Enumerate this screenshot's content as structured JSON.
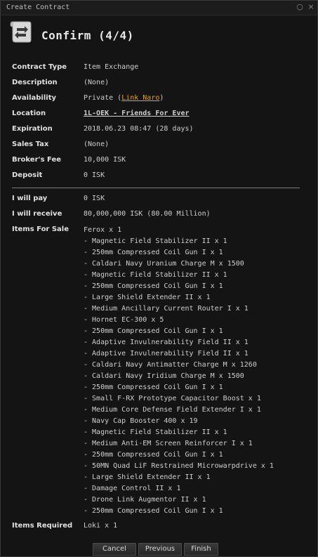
{
  "window": {
    "title": "Create Contract",
    "controls": [
      "minimize-icon",
      "close-icon"
    ]
  },
  "header": {
    "title": "Confirm (4/4)",
    "icon": "contract-scroll-icon"
  },
  "fields": {
    "contract_type": {
      "label": "Contract Type",
      "value": "Item Exchange"
    },
    "description": {
      "label": "Description",
      "value": "(None)"
    },
    "availability": {
      "label": "Availability",
      "prefix": "Private (",
      "link": "Link Naro",
      "suffix": ")"
    },
    "location": {
      "label": "Location",
      "link": "1L-OEK - Friends For Ever"
    },
    "expiration": {
      "label": "Expiration",
      "value": "2018.06.23 08:47 (28 days)"
    },
    "sales_tax": {
      "label": "Sales Tax",
      "value": "(None)"
    },
    "brokers_fee": {
      "label": "Broker's Fee",
      "value": "10,000 ISK"
    },
    "deposit": {
      "label": "Deposit",
      "value": "0 ISK"
    },
    "i_will_pay": {
      "label": "I will pay",
      "value": "0 ISK"
    },
    "i_will_receive": {
      "label": "I will receive",
      "value": "80,000,000 ISK (80.00 Million)"
    },
    "items_for_sale_label": "Items For Sale",
    "items_required": {
      "label": "Items Required",
      "value": "Loki x 1"
    }
  },
  "items_for_sale": [
    "Ferox x 1",
    " - Magnetic Field Stabilizer II x 1",
    " - 250mm Compressed Coil Gun I x 1",
    " - Caldari Navy Uranium Charge M x 1500",
    " - Magnetic Field Stabilizer II x 1",
    " - 250mm Compressed Coil Gun I x 1",
    " - Large Shield Extender II x 1",
    " - Medium Ancillary Current Router I x 1",
    " - Hornet EC-300 x 5",
    " - 250mm Compressed Coil Gun I x 1",
    " - Adaptive Invulnerability Field II x 1",
    " - Adaptive Invulnerability Field II x 1",
    " - Caldari Navy Antimatter Charge M x 1260",
    " - Caldari Navy Iridium Charge M x 1500",
    " - 250mm Compressed Coil Gun I x 1",
    " - Small F-RX Prototype Capacitor Boost x 1",
    " - Medium Core Defense Field Extender I x 1",
    " - Navy Cap Booster 400 x 19",
    " - Magnetic Field Stabilizer II x 1",
    " - Medium Anti-EM Screen Reinforcer I x 1",
    " - 250mm Compressed Coil Gun I x 1",
    " - 50MN Quad LiF Restrained Microwarpdrive x 1",
    " - Large Shield Extender II x 1",
    " - Damage Control II x 1",
    " - Drone Link Augmentor II x 1",
    " - 250mm Compressed Coil Gun I x 1"
  ],
  "buttons": {
    "cancel": "Cancel",
    "previous": "Previous",
    "finish": "Finish"
  },
  "colors": {
    "link": "#e8a020",
    "background": "#141414",
    "text": "#cfcfcf"
  }
}
